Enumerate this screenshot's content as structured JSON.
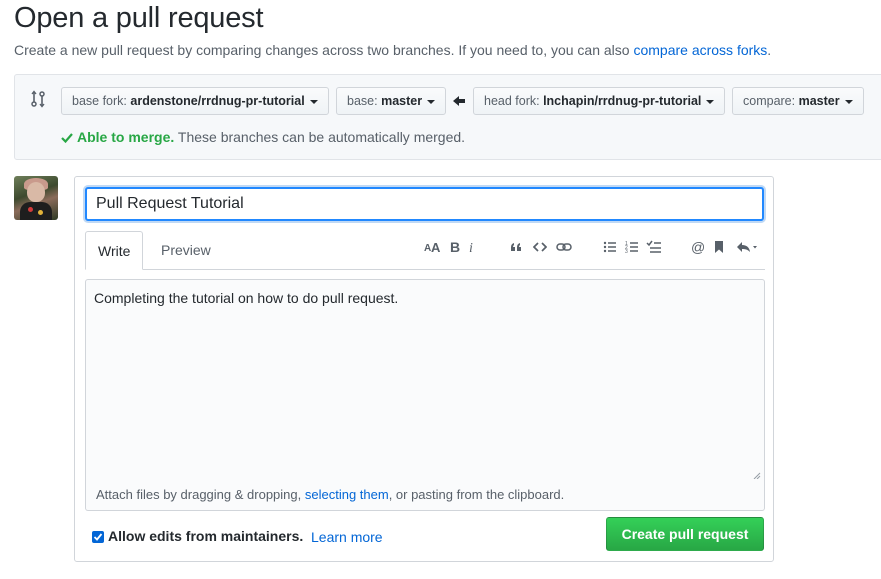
{
  "header": {
    "title": "Open a pull request",
    "subtitle_prefix": "Create a new pull request by comparing changes across two branches. If you need to, you can also",
    "subtitle_link": "compare across forks",
    "subtitle_suffix": "."
  },
  "compare": {
    "icon": "git-compare-icon",
    "base_fork_label": "base fork:",
    "base_fork_value": "ardenstone/rrdnug-pr-tutorial",
    "base_label": "base:",
    "base_value": "master",
    "arrow_icon": "arrow-left-icon",
    "head_fork_label": "head fork:",
    "head_fork_value": "lnchapin/rrdnug-pr-tutorial",
    "compare_label": "compare:",
    "compare_value": "master",
    "merge_status": "Able to merge.",
    "merge_message": "These branches can be automatically merged.",
    "status_color": "#28a745"
  },
  "form": {
    "title_value": "Pull Request Tutorial",
    "tabs": [
      {
        "label": "Write",
        "active": true
      },
      {
        "label": "Preview",
        "active": false
      }
    ],
    "toolbar": {
      "header_icon": "text-size-icon",
      "bold_icon": "bold-icon",
      "italic_icon": "italic-icon",
      "quote_icon": "quote-icon",
      "code_icon": "code-icon",
      "link_icon": "link-icon",
      "ul_icon": "unordered-list-icon",
      "ol_icon": "ordered-list-icon",
      "task_icon": "task-list-icon",
      "mention_icon": "mention-icon",
      "reference_icon": "bookmark-icon",
      "reply_icon": "reply-icon"
    },
    "body_value": "Completing the tutorial on how to do pull request.",
    "attach_prefix": "Attach files by dragging & dropping, ",
    "attach_link": "selecting them",
    "attach_suffix": ", or pasting from the clipboard.",
    "allow_edits_label": "Allow edits from maintainers.",
    "allow_edits_checked": true,
    "learn_more": "Learn more",
    "submit_label": "Create pull request"
  },
  "colors": {
    "link": "#0366d6",
    "primary_button": "#28a745",
    "focus_border": "#2188ff"
  }
}
